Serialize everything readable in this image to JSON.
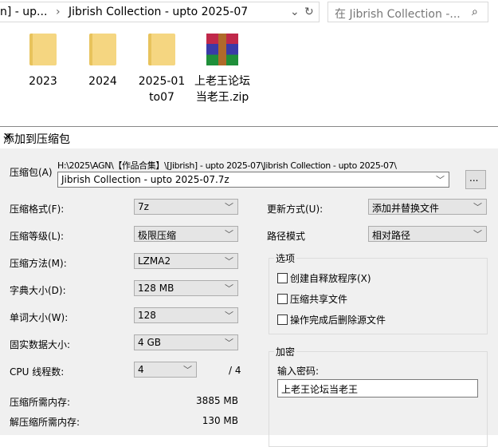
{
  "explorer": {
    "breadcrumb_prev": "n]  - up...",
    "breadcrumb_current": "Jibrish Collection - upto 2025-07",
    "search_placeholder": "在 Jibrish Collection -...",
    "items": [
      {
        "name": "2023",
        "type": "folder"
      },
      {
        "name": "2024",
        "type": "folder"
      },
      {
        "name": "2025-01 to07",
        "type": "folder"
      },
      {
        "name": "上老王论坛当老王.zip",
        "type": "archive"
      }
    ]
  },
  "dialog": {
    "title": "添加到压缩包",
    "archive_label": "压缩包(A)",
    "archive_path": "H:\\2025\\AGN\\【作品合集】\\[Jibrish]  - upto 2025-07\\Jibrish Collection - upto 2025-07\\",
    "archive_name": "Jibrish Collection - upto 2025-07.7z",
    "browse_label": "...",
    "fields": [
      {
        "label": "压缩格式(F):",
        "value": "7z"
      },
      {
        "label": "压缩等级(L):",
        "value": "极限压缩"
      },
      {
        "label": "压缩方法(M):",
        "value": "LZMA2"
      },
      {
        "label": "字典大小(D):",
        "value": "128 MB"
      },
      {
        "label": "单词大小(W):",
        "value": "128"
      },
      {
        "label": "固实数据大小:",
        "value": "4 GB"
      }
    ],
    "cpu": {
      "label": "CPU 线程数:",
      "value": "4",
      "max": "/ 4"
    },
    "mem_compress": {
      "label": "压缩所需内存:",
      "value": "3885 MB"
    },
    "mem_decompress": {
      "label": "解压缩所需内存:",
      "value": "130 MB"
    },
    "update": {
      "label": "更新方式(U):",
      "value": "添加并替换文件"
    },
    "pathmode": {
      "label": "路径模式",
      "value": "相对路径"
    },
    "options": {
      "title": "选项",
      "items": [
        "创建自释放程序(X)",
        "压缩共享文件",
        "操作完成后删除源文件"
      ]
    },
    "encryption": {
      "title": "加密",
      "password_label": "输入密码:",
      "password": "上老王论坛当老王"
    }
  }
}
